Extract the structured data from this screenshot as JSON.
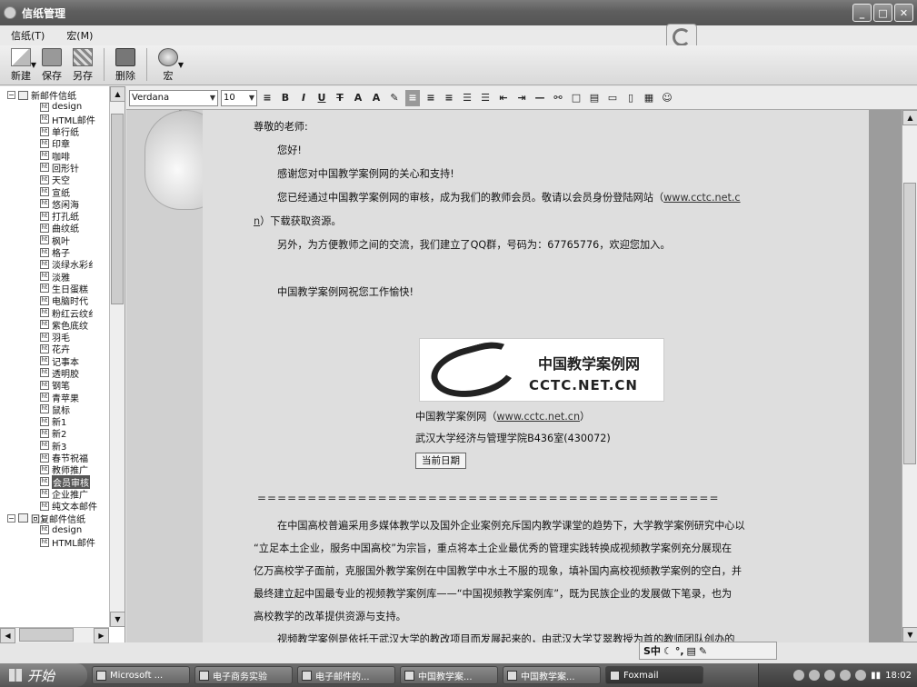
{
  "window": {
    "title": "信纸管理",
    "buttons": [
      "_",
      "□",
      "✕"
    ]
  },
  "menu": [
    "信纸(T)",
    "宏(M)"
  ],
  "toolbar": [
    {
      "id": "new",
      "label": "新建",
      "icon": "new-icon"
    },
    {
      "id": "save",
      "label": "保存",
      "icon": "save-icon"
    },
    {
      "id": "saveas",
      "label": "另存",
      "icon": "save-as-icon"
    },
    {
      "id": "delete",
      "label": "删除",
      "icon": "delete-icon"
    },
    {
      "id": "macro",
      "label": "宏",
      "icon": "macro-icon"
    }
  ],
  "tree": [
    {
      "type": "folder",
      "label": "新邮件信纸",
      "expanded": true
    },
    {
      "type": "leaf",
      "label": "design"
    },
    {
      "type": "leaf",
      "label": "HTML邮件"
    },
    {
      "type": "leaf",
      "label": "单行纸"
    },
    {
      "type": "leaf",
      "label": "印章"
    },
    {
      "type": "leaf",
      "label": "咖啡"
    },
    {
      "type": "leaf",
      "label": "回形针"
    },
    {
      "type": "leaf",
      "label": "天空"
    },
    {
      "type": "leaf",
      "label": "宣纸"
    },
    {
      "type": "leaf",
      "label": "悠闲海"
    },
    {
      "type": "leaf",
      "label": "打孔纸"
    },
    {
      "type": "leaf",
      "label": "曲纹纸"
    },
    {
      "type": "leaf",
      "label": "枫叶"
    },
    {
      "type": "leaf",
      "label": "格子"
    },
    {
      "type": "leaf",
      "label": "淡绿水彩纟"
    },
    {
      "type": "leaf",
      "label": "淡雅"
    },
    {
      "type": "leaf",
      "label": "生日蛋糕"
    },
    {
      "type": "leaf",
      "label": "电脑时代"
    },
    {
      "type": "leaf",
      "label": "粉红云纹纟"
    },
    {
      "type": "leaf",
      "label": "紫色底纹"
    },
    {
      "type": "leaf",
      "label": "羽毛"
    },
    {
      "type": "leaf",
      "label": "花卉"
    },
    {
      "type": "leaf",
      "label": "记事本"
    },
    {
      "type": "leaf",
      "label": "透明胶"
    },
    {
      "type": "leaf",
      "label": "钢笔"
    },
    {
      "type": "leaf",
      "label": "青苹果"
    },
    {
      "type": "leaf",
      "label": "鼠标"
    },
    {
      "type": "leaf",
      "label": "新1"
    },
    {
      "type": "leaf",
      "label": "新2"
    },
    {
      "type": "leaf",
      "label": "新3"
    },
    {
      "type": "leaf",
      "label": "春节祝福"
    },
    {
      "type": "leaf",
      "label": "教师推广"
    },
    {
      "type": "leaf",
      "label": "会员审核",
      "selected": true
    },
    {
      "type": "leaf",
      "label": "企业推广"
    },
    {
      "type": "leaf",
      "label": "纯文本邮件"
    },
    {
      "type": "folder",
      "label": "回复邮件信纸",
      "expanded": true
    },
    {
      "type": "leaf",
      "label": "design"
    },
    {
      "type": "leaf",
      "label": "HTML邮件"
    }
  ],
  "format": {
    "font": "Verdana",
    "size": "10",
    "buttons": [
      "≡",
      "B",
      "I",
      "U",
      "T",
      "A",
      "A",
      "✎",
      "≡",
      "≡",
      "≡",
      "☰",
      "☰",
      "⇤",
      "⇥",
      "—",
      "⚯",
      "□",
      "▤",
      "▭",
      "▯",
      "▦",
      "☺"
    ]
  },
  "email": {
    "greeting": "尊敬的老师:",
    "line1": "您好!",
    "line2": "感谢您对中国教学案例网的关心和支持!",
    "line3a": "您已经通过中国教学案例网的审核，成为我们的教师会员。敬请以会员身份登陆网站（",
    "line3link": "www.cctc.net.c",
    "line3b_link": "n",
    "line3b": "）下载获取资源。",
    "line4": "另外，为方便教师之间的交流，我们建立了QQ群，号码为：67765776，欢迎您加入。",
    "line5": "中国教学案例网祝您工作愉快!",
    "logo_cn": "中国教学案例网",
    "logo_en": "CCTC.NET.CN",
    "sig1a": "中国教学案例网（",
    "sig1link": "www.cctc.net.cn",
    "sig1b": "）",
    "sig2": "武汉大学经济与管理学院B436室(430072)",
    "date_button": "当前日期",
    "separator": "==============================================",
    "para1": "在中国高校普遍采用多媒体教学以及国外企业案例充斥国内教学课堂的趋势下，大学教学案例研究中心以",
    "para2": "“立足本土企业，服务中国高校”为宗旨，重点将本土企业最优秀的管理实践转换成视频教学案例充分展现在",
    "para3": "亿万高校学子面前，克服国外教学案例在中国教学中水土不服的现象，填补国内高校视频教学案例的空白，并",
    "para4": "最终建立起中国最专业的视频教学案例库——“中国视频教学案例库”，既为民族企业的发展做下笔录，也为",
    "para5": "高校教学的改革提供资源与支持。",
    "para6": "视频教学案例是依托于武汉大学的教改项目而发展起来的，由武汉大学艾翠教授为首的教师团队创办的"
  },
  "ime": {
    "text": "S中"
  },
  "taskbar": {
    "start": "开始",
    "tasks": [
      "Microsoft ...",
      "电子商务实验",
      "电子邮件的...",
      "中国教学案...",
      "中国教学案...",
      "Foxmail"
    ],
    "active_task": 5,
    "clock": "18:02"
  }
}
